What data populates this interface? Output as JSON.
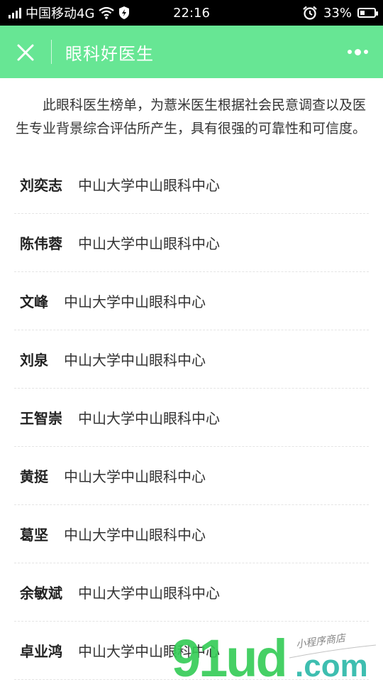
{
  "status_bar": {
    "carrier": "中国移动4G",
    "time": "22:16",
    "battery": "33%",
    "battery_level": 0.33
  },
  "nav": {
    "title": "眼科好医生"
  },
  "intro_text": "此眼科医生榜单，为薏米医生根据社会民意调查以及医生专业背景综合评估所产生，具有很强的可靠性和可信度。",
  "doctors": [
    {
      "name": "刘奕志",
      "hospital": "中山大学中山眼科中心"
    },
    {
      "name": "陈伟蓉",
      "hospital": "中山大学中山眼科中心"
    },
    {
      "name": "文峰",
      "hospital": "中山大学中山眼科中心"
    },
    {
      "name": "刘泉",
      "hospital": "中山大学中山眼科中心"
    },
    {
      "name": "王智崇",
      "hospital": "中山大学中山眼科中心"
    },
    {
      "name": "黄挺",
      "hospital": "中山大学中山眼科中心"
    },
    {
      "name": "葛坚",
      "hospital": "中山大学中山眼科中心"
    },
    {
      "name": "余敏斌",
      "hospital": "中山大学中山眼科中心"
    },
    {
      "name": "卓业鸿",
      "hospital": "中山大学中山眼科中心"
    }
  ],
  "watermark": {
    "logo": "91ud.com",
    "tagline": "小程序商店"
  },
  "colors": {
    "nav_bg": "#67e694",
    "watermark_green": "#33cc55",
    "watermark_teal": "#2ab8a8"
  }
}
